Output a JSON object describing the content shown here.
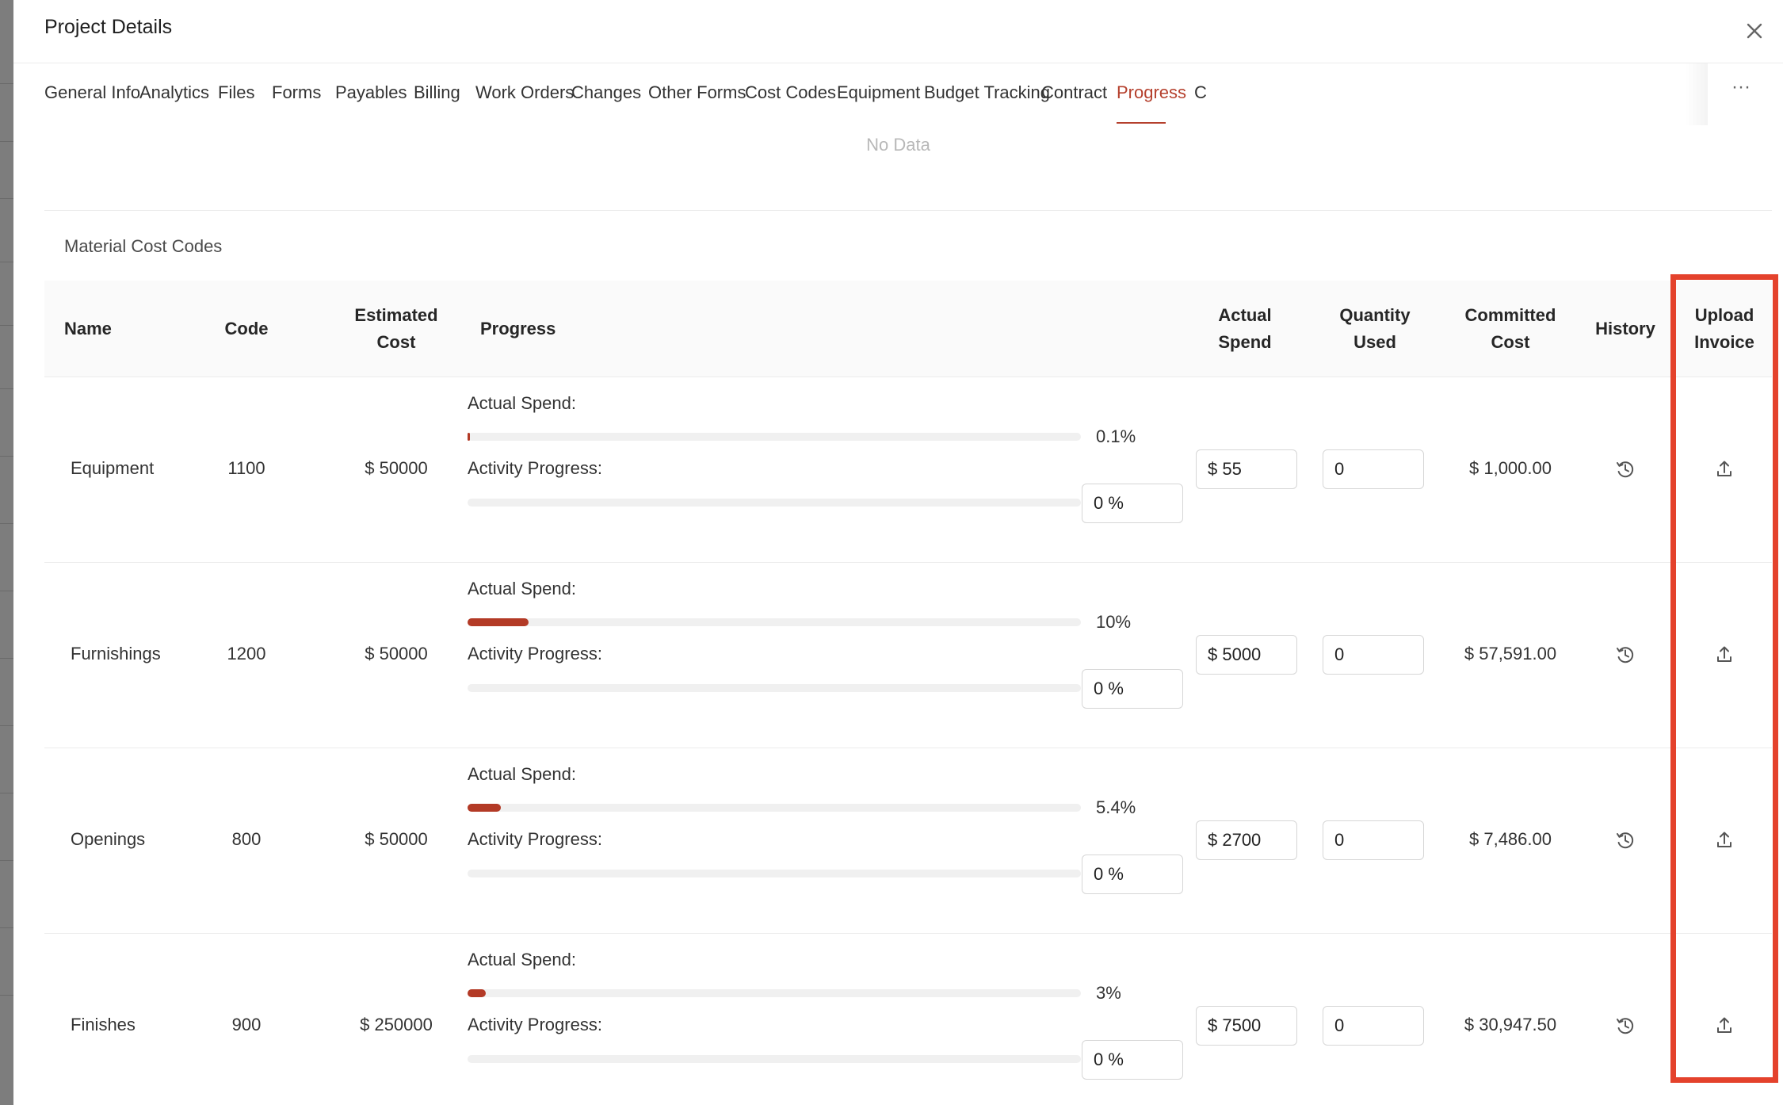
{
  "modal": {
    "title": "Project Details"
  },
  "tabs": [
    {
      "label": "General Info"
    },
    {
      "label": "Analytics"
    },
    {
      "label": "Files"
    },
    {
      "label": "Forms"
    },
    {
      "label": "Payables"
    },
    {
      "label": "Billing"
    },
    {
      "label": "Work Orders"
    },
    {
      "label": "Changes"
    },
    {
      "label": "Other Forms"
    },
    {
      "label": "Cost Codes"
    },
    {
      "label": "Equipment"
    },
    {
      "label": "Budget Tracking"
    },
    {
      "label": "Contract"
    },
    {
      "label": "Progress"
    },
    {
      "label": "C"
    }
  ],
  "active_tab": "Progress",
  "tab_more_label": "···",
  "empty_state": "No Data",
  "section": {
    "title": "Material Cost Codes"
  },
  "columns": {
    "name": "Name",
    "code": "Code",
    "estimated_cost": "Estimated Cost",
    "progress": "Progress",
    "actual_spend": "Actual Spend",
    "quantity_used": "Quantity Used",
    "committed_cost": "Committed Cost",
    "history": "History",
    "upload_invoice": "Upload Invoice"
  },
  "progress_labels": {
    "actual_spend": "Actual Spend:",
    "activity_progress": "Activity Progress:"
  },
  "rows": [
    {
      "name": "Equipment",
      "code": "1100",
      "estimated_cost": "$ 50000",
      "spend_percent_label": "0.1%",
      "spend_fraction": 0.001,
      "activity_fraction": 0,
      "activity_value": "0 %",
      "actual_spend_value": "$ 55",
      "quantity_used_value": "0",
      "committed_cost": "$ 1,000.00"
    },
    {
      "name": "Furnishings",
      "code": "1200",
      "estimated_cost": "$ 50000",
      "spend_percent_label": "10%",
      "spend_fraction": 0.1,
      "activity_fraction": 0,
      "activity_value": "0 %",
      "actual_spend_value": "$ 5000",
      "quantity_used_value": "0",
      "committed_cost": "$ 57,591.00"
    },
    {
      "name": "Openings",
      "code": "800",
      "estimated_cost": "$ 50000",
      "spend_percent_label": "5.4%",
      "spend_fraction": 0.054,
      "activity_fraction": 0,
      "activity_value": "0 %",
      "actual_spend_value": "$ 2700",
      "quantity_used_value": "0",
      "committed_cost": "$ 7,486.00"
    },
    {
      "name": "Finishes",
      "code": "900",
      "estimated_cost": "$ 250000",
      "spend_percent_label": "3%",
      "spend_fraction": 0.03,
      "activity_fraction": 0,
      "activity_value": "0 %",
      "actual_spend_value": "$ 7500",
      "quantity_used_value": "0",
      "committed_cost": "$ 30,947.50"
    }
  ],
  "icons": {
    "close": "close-icon",
    "history": "history-icon",
    "upload": "upload-icon"
  },
  "colors": {
    "accent": "#b5402d",
    "progress_fill": "#b33a26",
    "highlight": "#e4422c"
  }
}
